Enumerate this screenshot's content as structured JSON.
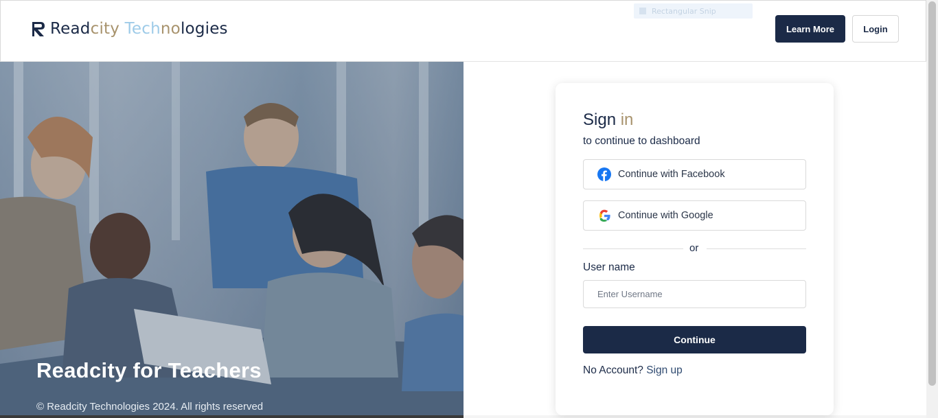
{
  "header": {
    "logo_parts": [
      {
        "text": "Read",
        "tone": "dark"
      },
      {
        "text": "city",
        "tone": "gold"
      },
      {
        "text": " Tech",
        "tone": "light"
      },
      {
        "text": "no",
        "tone": "gold"
      },
      {
        "text": "logies",
        "tone": "dark"
      }
    ],
    "ghost_text": "Rectangular Snip",
    "learn_more": "Learn More",
    "login": "Login"
  },
  "hero": {
    "title": "Readcity for Teachers",
    "footer": "© Readcity Technologies 2024. All rights reserved"
  },
  "signin": {
    "title_main": "Sign",
    "title_accent": "in",
    "subtitle": "to continue to dashboard",
    "facebook": "Continue with Facebook",
    "google": "Continue with Google",
    "or": "or",
    "username_label": "User name",
    "username_placeholder": "Enter Username",
    "continue": "Continue",
    "no_account": "No Account?",
    "signup": "Sign up"
  },
  "colors": {
    "navy": "#1b2a47",
    "gold": "#a8936d",
    "light_blue": "#9ecbe8",
    "facebook_blue": "#1877f2"
  },
  "icons": {
    "logo": "readcity-logo-icon",
    "facebook": "facebook-icon",
    "google": "google-icon"
  }
}
